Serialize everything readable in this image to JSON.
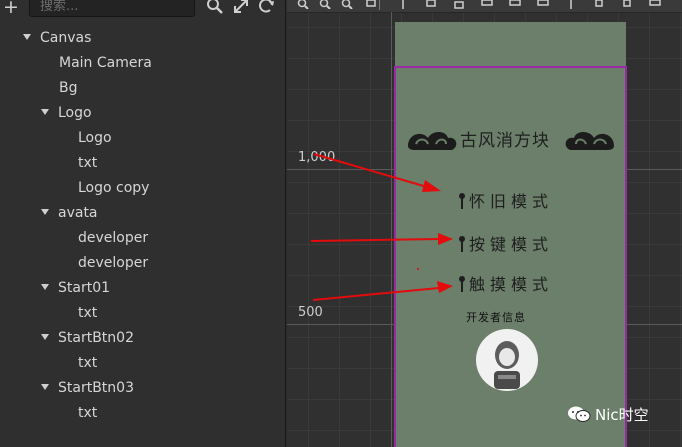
{
  "hierarchy": {
    "search_placeholder": "搜索...",
    "items": [
      {
        "label": "Canvas",
        "expanded": true
      },
      {
        "label": "Main Camera"
      },
      {
        "label": "Bg"
      },
      {
        "label": "Logo",
        "expanded": true
      },
      {
        "label": "Logo"
      },
      {
        "label": "txt"
      },
      {
        "label": "Logo copy"
      },
      {
        "label": "avata",
        "expanded": true
      },
      {
        "label": "developer"
      },
      {
        "label": "developer"
      },
      {
        "label": "Start01",
        "expanded": true
      },
      {
        "label": "txt"
      },
      {
        "label": "StartBtn02",
        "expanded": true
      },
      {
        "label": "txt"
      },
      {
        "label": "StartBtn03",
        "expanded": true
      },
      {
        "label": "txt"
      }
    ]
  },
  "scene": {
    "ruler_1000": "1,000",
    "ruler_500": "500",
    "game_title": "古风消方块",
    "menu": [
      "怀旧模式",
      "按键模式",
      "触摸模式"
    ],
    "developer_text": "开发者信息",
    "frame_color": "#9a29a6",
    "bg_color": "#6b7f6a"
  },
  "watermark": "Nic时空"
}
